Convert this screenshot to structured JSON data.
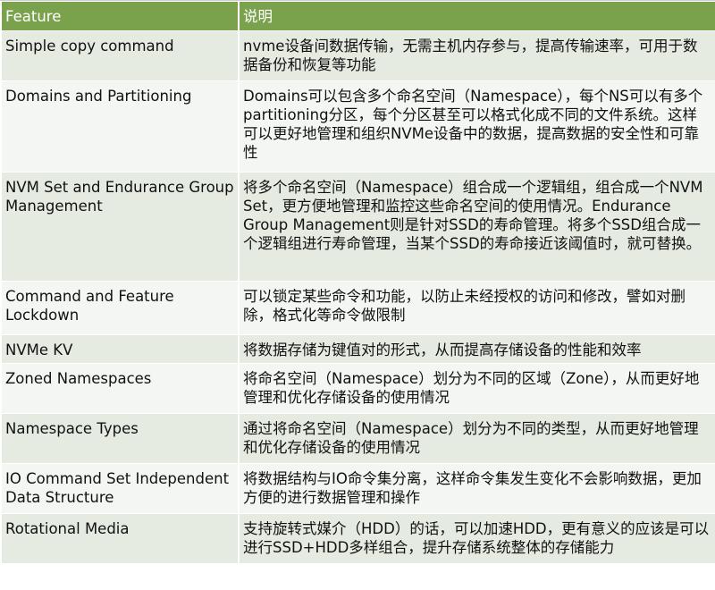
{
  "header": {
    "feature": "Feature",
    "description": "说明"
  },
  "rows": [
    {
      "feature": "Simple copy command",
      "description": "nvme设备间数据传输，无需主机内存参与，提高传输速率，可用于数据备份和恢复等功能"
    },
    {
      "feature": "Domains and Partitioning",
      "description": "Domains可以包含多个命名空间（Namespace），每个NS可以有多个partitioning分区，每个分区甚至可以格式化成不同的文件系统。这样可以更好地管理和组织NVMe设备中的数据，提高数据的安全性和可靠性"
    },
    {
      "feature": "NVM Set and Endurance Group Management",
      "description": "将多个命名空间（Namespace）组合成一个逻辑组，组合成一个NVM Set，更方便地管理和监控这些命名空间的使用情况。Endurance Group Management则是针对SSD的寿命管理。将多个SSD组合成一个逻辑组进行寿命管理，当某个SSD的寿命接近该阈值时，就可替换。"
    },
    {
      "feature": "Command and Feature Lockdown",
      "description": "可以锁定某些命令和功能，以防止未经授权的访问和修改，譬如对删除，格式化等命令做限制"
    },
    {
      "feature": "NVMe KV",
      "description": "将数据存储为键值对的形式，从而提高存储设备的性能和效率"
    },
    {
      "feature": "Zoned Namespaces",
      "description": "将命名空间（Namespace）划分为不同的区域（Zone），从而更好地管理和优化存储设备的使用情况"
    },
    {
      "feature": "Namespace Types",
      "description": "通过将命名空间（Namespace）划分为不同的类型，从而更好地管理和优化存储设备的使用情况"
    },
    {
      "feature": "IO Command Set Independent Data Structure",
      "description": "将数据结构与IO命令集分离，这样命令集发生变化不会影响数据，更加方便的进行数据管理和操作"
    },
    {
      "feature": "Rotational Media",
      "description": "支持旋转式媒介（HDD）的话，可以加速HDD，更有意义的应该是可以进行SSD+HDD多样组合，提升存储系统整体的存储能力"
    }
  ],
  "colors": {
    "header_bg": "#7aa24c",
    "row_odd": "#e6ebe2",
    "row_even": "#f4f6f3"
  }
}
